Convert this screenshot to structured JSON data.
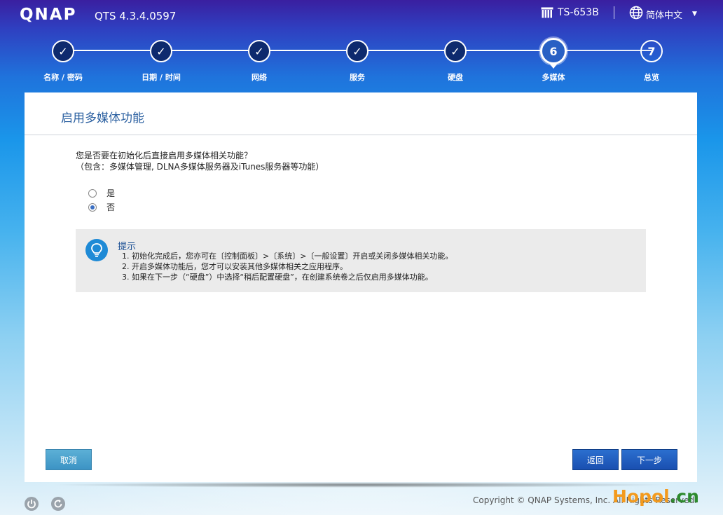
{
  "header": {
    "logo": "QNAP",
    "version": "QTS 4.3.4.0597",
    "device_name": "TS-653B",
    "language": "简体中文"
  },
  "stepper": {
    "current_step": 6,
    "steps": [
      {
        "label": "名称 / 密码",
        "state": "done",
        "number": "1"
      },
      {
        "label": "日期 / 时间",
        "state": "done",
        "number": "2"
      },
      {
        "label": "网络",
        "state": "done",
        "number": "3"
      },
      {
        "label": "服务",
        "state": "done",
        "number": "4"
      },
      {
        "label": "硬盘",
        "state": "done",
        "number": "5"
      },
      {
        "label": "多媒体",
        "state": "active",
        "number": "6"
      },
      {
        "label": "总览",
        "state": "future",
        "number": "7"
      }
    ]
  },
  "panel": {
    "title": "启用多媒体功能",
    "question_line1": "您是否要在初始化后直接启用多媒体相关功能？",
    "question_line2": "（包含：多媒体管理, DLNA多媒体服务器及iTunes服务器等功能）",
    "options": [
      {
        "label": "是",
        "checked": false
      },
      {
        "label": "否",
        "checked": true
      }
    ],
    "tip": {
      "title": "提示",
      "items": [
        "1.  初始化完成后，您亦可在〔控制面板〕>〔系统〕>〔一般设置〕开启或关闭多媒体相关功能。",
        "2.  开启多媒体功能后，您才可以安装其他多媒体相关之应用程序。",
        "3.  如果在下一步（“硬盘”）中选择“稍后配置硬盘”，在创建系统卷之后仅启用多媒体功能。"
      ]
    },
    "buttons": {
      "cancel": "取消",
      "back": "返回",
      "next": "下一步"
    }
  },
  "footer": {
    "copyright": "Copyright © QNAP Systems, Inc. All Rights Reserved.",
    "watermark_main": "Hopol",
    "watermark_tld": ".cn"
  },
  "colors": {
    "accent": "#2a5fa0",
    "primary_button": "#1f5cc0",
    "cancel_button": "#4aa2cf",
    "watermark_orange": "#f39a1d",
    "watermark_green": "#2d8a2d"
  }
}
